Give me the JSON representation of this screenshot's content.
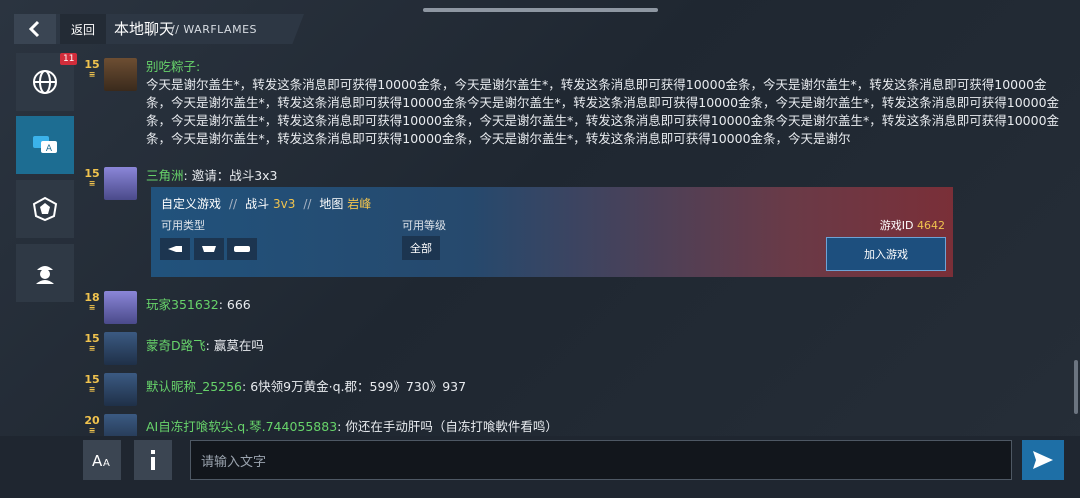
{
  "header": {
    "back_label": "返回",
    "title": "本地聊天",
    "subtitle": "// WARFLAMES"
  },
  "sidebar": {
    "badge": "11",
    "items": [
      "globe",
      "chat-translate",
      "faction",
      "troop"
    ]
  },
  "messages": [
    {
      "level": "15",
      "name": "别吃粽子",
      "text": "今天是谢尔盖生*，转发这条消息即可获得10000金条，今天是谢尔盖生*，转发这条消息即可获得10000金条，今天是谢尔盖生*，转发这条消息即可获得10000金条，今天是谢尔盖生*，转发这条消息即可获得10000金条今天是谢尔盖生*，转发这条消息即可获得10000金条，今天是谢尔盖生*，转发这条消息即可获得10000金条，今天是谢尔盖生*，转发这条消息即可获得10000金条，今天是谢尔盖生*，转发这条消息即可获得10000金条今天是谢尔盖生*，转发这条消息即可获得10000金条，今天是谢尔盖生*，转发这条消息即可获得10000金条，今天是谢尔盖生*，转发这条消息即可获得10000金条，今天是谢尔"
    },
    {
      "level": "15",
      "name": "三角洲",
      "text": "邀请：战斗3x3"
    },
    {
      "level": "18",
      "name": "玩家351632",
      "text": "666"
    },
    {
      "level": "15",
      "name": "蒙奇D路飞",
      "text": "赢莫在吗"
    },
    {
      "level": "15",
      "name": "默认昵称_25256",
      "text": "6快领9万黄金·q.郡：599》730》937"
    },
    {
      "level": "20",
      "name": "AI自冻打喰软尖.q.琴.744055883",
      "text": "你还在手动肝吗（自冻打喰軟件看鸣）"
    }
  ],
  "invite": {
    "mode": "自定义游戏",
    "battle_label": "战斗",
    "battle_value": "3v3",
    "map_label": "地图",
    "map_value": "岩峰",
    "types_label": "可用类型",
    "levels_label": "可用等级",
    "level_value": "全部",
    "game_id_label": "游戏ID",
    "game_id": "4642",
    "join_label": "加入游戏"
  },
  "input": {
    "placeholder": "请输入文字"
  },
  "colors": {
    "name": "#67d36a",
    "level": "#f0c34e",
    "accent": "#1e6fa6"
  }
}
